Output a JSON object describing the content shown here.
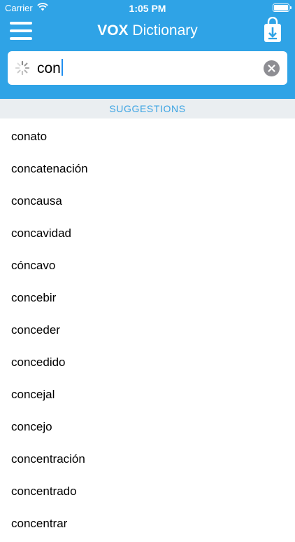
{
  "status_bar": {
    "carrier": "Carrier",
    "time": "1:05 PM"
  },
  "header": {
    "brand": "VOX",
    "title_rest": "Dictionary",
    "menu_icon": "hamburger-menu-icon",
    "download_icon": "download-bag-icon",
    "background_color": "#2fa3e6"
  },
  "search": {
    "value": "con",
    "loading_icon": "spinner-icon",
    "clear_icon": "clear-icon"
  },
  "suggestions": {
    "header": "SUGGESTIONS",
    "items": [
      "conato",
      "concatenación",
      "concausa",
      "concavidad",
      "cóncavo",
      "concebir",
      "conceder",
      "concedido",
      "concejal",
      "concejo",
      "concentración",
      "concentrado",
      "concentrar"
    ]
  }
}
